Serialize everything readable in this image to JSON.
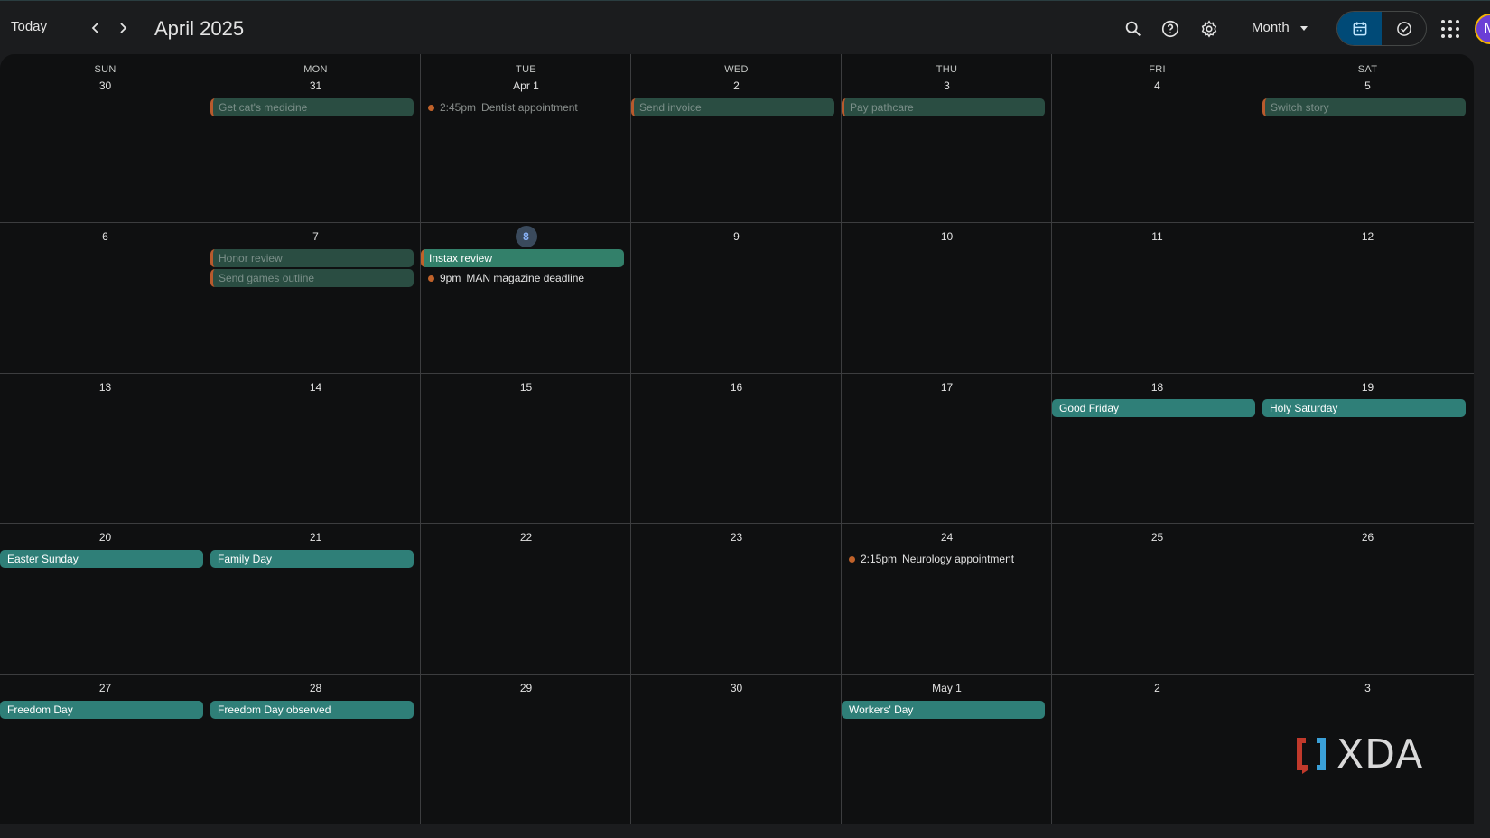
{
  "header": {
    "today_label": "Today",
    "title": "April 2025",
    "view_label": "Month",
    "avatar_initial": "M"
  },
  "colors": {
    "event_green": "#33806a",
    "holiday_teal": "#2f7f78",
    "task_orange": "#c0622a",
    "today_badge": "#3a4a5c",
    "toggle_active": "#004a77"
  },
  "weekdays": [
    "SUN",
    "MON",
    "TUE",
    "WED",
    "THU",
    "FRI",
    "SAT"
  ],
  "weeks": [
    [
      "30",
      "31",
      "Apr 1",
      "2",
      "3",
      "4",
      "5"
    ],
    [
      "6",
      "7",
      "8",
      "9",
      "10",
      "11",
      "12"
    ],
    [
      "13",
      "14",
      "15",
      "16",
      "17",
      "18",
      "19"
    ],
    [
      "20",
      "21",
      "22",
      "23",
      "24",
      "25",
      "26"
    ],
    [
      "27",
      "28",
      "29",
      "30",
      "May 1",
      "2",
      "3"
    ]
  ],
  "events": {
    "cats_medicine": "Get cat's medicine",
    "dentist_time": "2:45pm",
    "dentist": "Dentist appointment",
    "send_invoice": "Send invoice",
    "pay_pathcare": "Pay pathcare",
    "switch_story": "Switch story",
    "honor_review": "Honor review",
    "send_games_outline": "Send games outline",
    "instax_review": "Instax review",
    "man_time": "9pm",
    "man_deadline": "MAN magazine deadline",
    "good_friday": "Good Friday",
    "holy_saturday": "Holy Saturday",
    "easter_sunday": "Easter Sunday",
    "family_day": "Family Day",
    "neuro_time": "2:15pm",
    "neuro": "Neurology appointment",
    "freedom_day": "Freedom Day",
    "freedom_day_observed": "Freedom Day observed",
    "workers_day": "Workers' Day"
  },
  "watermark": "XDA"
}
